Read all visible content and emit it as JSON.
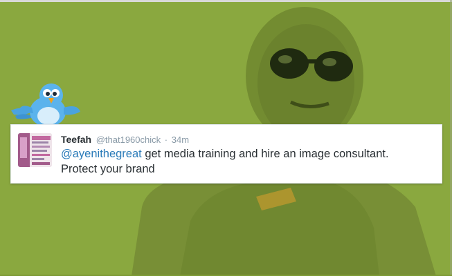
{
  "tweet": {
    "display_name": "Teefah",
    "handle": "@that1960chick",
    "separator": "·",
    "time": "34m",
    "mention": "@ayenithegreat",
    "text_line1": " get media training and hire an image consultant.",
    "text_line2": "Protect your brand"
  },
  "colors": {
    "overlay": "#8aa83f",
    "mention": "#2b7bb9",
    "name": "#292f33",
    "muted": "#8899a6",
    "bird": "#5bb3ec"
  },
  "icons": {
    "mascot": "twitter-bird-icon"
  }
}
